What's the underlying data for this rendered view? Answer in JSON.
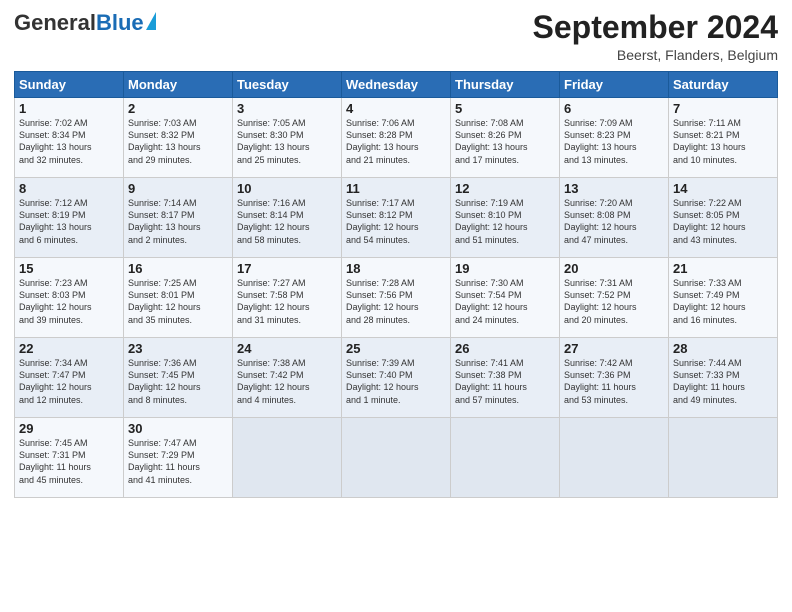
{
  "header": {
    "logo_general": "General",
    "logo_blue": "Blue",
    "title": "September 2024",
    "location": "Beerst, Flanders, Belgium"
  },
  "columns": [
    "Sunday",
    "Monday",
    "Tuesday",
    "Wednesday",
    "Thursday",
    "Friday",
    "Saturday"
  ],
  "rows": [
    [
      {
        "day": "1",
        "info": "Sunrise: 7:02 AM\nSunset: 8:34 PM\nDaylight: 13 hours\nand 32 minutes."
      },
      {
        "day": "2",
        "info": "Sunrise: 7:03 AM\nSunset: 8:32 PM\nDaylight: 13 hours\nand 29 minutes."
      },
      {
        "day": "3",
        "info": "Sunrise: 7:05 AM\nSunset: 8:30 PM\nDaylight: 13 hours\nand 25 minutes."
      },
      {
        "day": "4",
        "info": "Sunrise: 7:06 AM\nSunset: 8:28 PM\nDaylight: 13 hours\nand 21 minutes."
      },
      {
        "day": "5",
        "info": "Sunrise: 7:08 AM\nSunset: 8:26 PM\nDaylight: 13 hours\nand 17 minutes."
      },
      {
        "day": "6",
        "info": "Sunrise: 7:09 AM\nSunset: 8:23 PM\nDaylight: 13 hours\nand 13 minutes."
      },
      {
        "day": "7",
        "info": "Sunrise: 7:11 AM\nSunset: 8:21 PM\nDaylight: 13 hours\nand 10 minutes."
      }
    ],
    [
      {
        "day": "8",
        "info": "Sunrise: 7:12 AM\nSunset: 8:19 PM\nDaylight: 13 hours\nand 6 minutes."
      },
      {
        "day": "9",
        "info": "Sunrise: 7:14 AM\nSunset: 8:17 PM\nDaylight: 13 hours\nand 2 minutes."
      },
      {
        "day": "10",
        "info": "Sunrise: 7:16 AM\nSunset: 8:14 PM\nDaylight: 12 hours\nand 58 minutes."
      },
      {
        "day": "11",
        "info": "Sunrise: 7:17 AM\nSunset: 8:12 PM\nDaylight: 12 hours\nand 54 minutes."
      },
      {
        "day": "12",
        "info": "Sunrise: 7:19 AM\nSunset: 8:10 PM\nDaylight: 12 hours\nand 51 minutes."
      },
      {
        "day": "13",
        "info": "Sunrise: 7:20 AM\nSunset: 8:08 PM\nDaylight: 12 hours\nand 47 minutes."
      },
      {
        "day": "14",
        "info": "Sunrise: 7:22 AM\nSunset: 8:05 PM\nDaylight: 12 hours\nand 43 minutes."
      }
    ],
    [
      {
        "day": "15",
        "info": "Sunrise: 7:23 AM\nSunset: 8:03 PM\nDaylight: 12 hours\nand 39 minutes."
      },
      {
        "day": "16",
        "info": "Sunrise: 7:25 AM\nSunset: 8:01 PM\nDaylight: 12 hours\nand 35 minutes."
      },
      {
        "day": "17",
        "info": "Sunrise: 7:27 AM\nSunset: 7:58 PM\nDaylight: 12 hours\nand 31 minutes."
      },
      {
        "day": "18",
        "info": "Sunrise: 7:28 AM\nSunset: 7:56 PM\nDaylight: 12 hours\nand 28 minutes."
      },
      {
        "day": "19",
        "info": "Sunrise: 7:30 AM\nSunset: 7:54 PM\nDaylight: 12 hours\nand 24 minutes."
      },
      {
        "day": "20",
        "info": "Sunrise: 7:31 AM\nSunset: 7:52 PM\nDaylight: 12 hours\nand 20 minutes."
      },
      {
        "day": "21",
        "info": "Sunrise: 7:33 AM\nSunset: 7:49 PM\nDaylight: 12 hours\nand 16 minutes."
      }
    ],
    [
      {
        "day": "22",
        "info": "Sunrise: 7:34 AM\nSunset: 7:47 PM\nDaylight: 12 hours\nand 12 minutes."
      },
      {
        "day": "23",
        "info": "Sunrise: 7:36 AM\nSunset: 7:45 PM\nDaylight: 12 hours\nand 8 minutes."
      },
      {
        "day": "24",
        "info": "Sunrise: 7:38 AM\nSunset: 7:42 PM\nDaylight: 12 hours\nand 4 minutes."
      },
      {
        "day": "25",
        "info": "Sunrise: 7:39 AM\nSunset: 7:40 PM\nDaylight: 12 hours\nand 1 minute."
      },
      {
        "day": "26",
        "info": "Sunrise: 7:41 AM\nSunset: 7:38 PM\nDaylight: 11 hours\nand 57 minutes."
      },
      {
        "day": "27",
        "info": "Sunrise: 7:42 AM\nSunset: 7:36 PM\nDaylight: 11 hours\nand 53 minutes."
      },
      {
        "day": "28",
        "info": "Sunrise: 7:44 AM\nSunset: 7:33 PM\nDaylight: 11 hours\nand 49 minutes."
      }
    ],
    [
      {
        "day": "29",
        "info": "Sunrise: 7:45 AM\nSunset: 7:31 PM\nDaylight: 11 hours\nand 45 minutes."
      },
      {
        "day": "30",
        "info": "Sunrise: 7:47 AM\nSunset: 7:29 PM\nDaylight: 11 hours\nand 41 minutes."
      },
      {
        "day": "",
        "info": ""
      },
      {
        "day": "",
        "info": ""
      },
      {
        "day": "",
        "info": ""
      },
      {
        "day": "",
        "info": ""
      },
      {
        "day": "",
        "info": ""
      }
    ]
  ]
}
